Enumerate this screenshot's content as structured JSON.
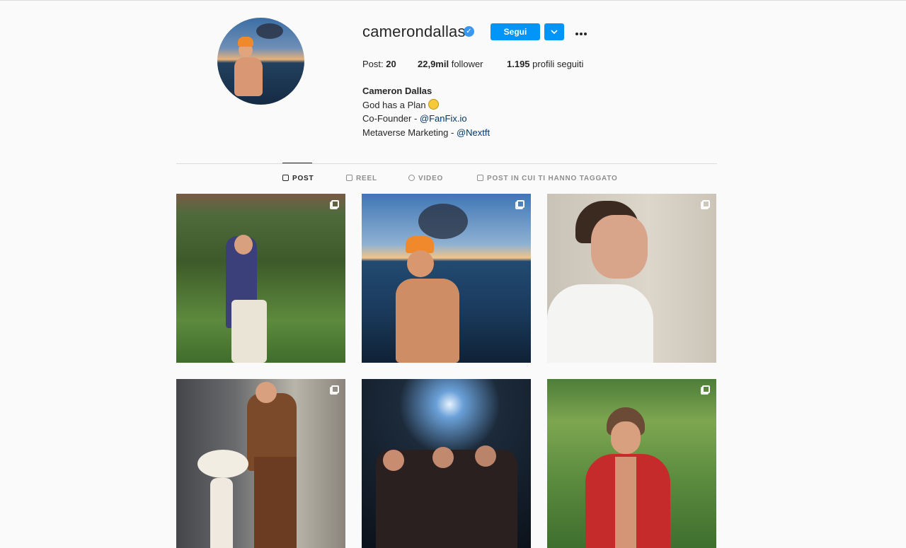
{
  "profile": {
    "username": "camerondallas",
    "verified_mark": "✓",
    "follow_label": "Segui",
    "stats": {
      "posts_label": "Post:",
      "posts_value": "20",
      "followers_value": "22,9mil",
      "followers_label": "follower",
      "following_value": "1.195",
      "following_label": "profili seguiti"
    },
    "bio": {
      "name": "Cameron Dallas",
      "line1": "God has a Plan",
      "line1_emoji": "sun",
      "line2_prefix": "Co-Founder - ",
      "line2_link": "@FanFix.io",
      "line3_prefix": "Metaverse Marketing - ",
      "line3_link": "@Nextft"
    }
  },
  "tabs": [
    {
      "label": "POST",
      "icon": "grid-icon",
      "active": true
    },
    {
      "label": "REEL",
      "icon": "reel-icon",
      "active": false
    },
    {
      "label": "VIDEO",
      "icon": "video-icon",
      "active": false
    },
    {
      "label": "POST IN CUI TI HANNO TAGGATO",
      "icon": "tag-icon",
      "active": false
    }
  ],
  "posts": [
    {
      "multi": true
    },
    {
      "multi": true
    },
    {
      "multi": true
    },
    {
      "multi": true
    },
    {
      "multi": false
    },
    {
      "multi": true
    }
  ],
  "colors": {
    "accent": "#0095f6",
    "verified": "#3897f0",
    "link": "#00376b",
    "background": "#fafafa"
  }
}
